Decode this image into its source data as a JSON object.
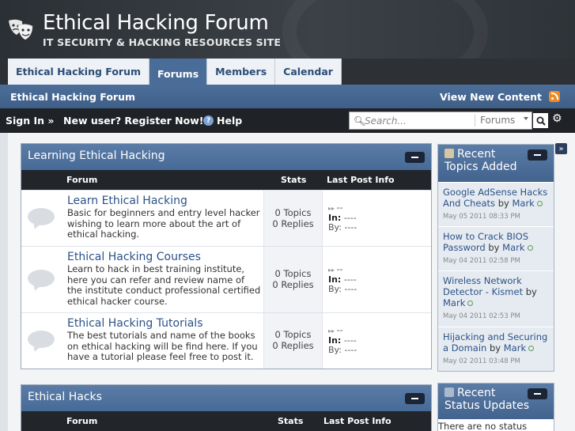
{
  "site": {
    "title": "Ethical Hacking Forum",
    "tagline": "IT SECURITY & HACKING RESOURCES SITE"
  },
  "tabs": [
    {
      "label": "Ethical Hacking Forum",
      "active": false
    },
    {
      "label": "Forums",
      "active": true
    },
    {
      "label": "Members",
      "active": false
    },
    {
      "label": "Calendar",
      "active": false
    }
  ],
  "navbar": {
    "breadcrumb": "Ethical Hacking Forum",
    "view_new_content": "View New Content",
    "rss_icon": "rss-icon"
  },
  "userbar": {
    "sign_in": "Sign In »",
    "register": "New user? Register Now!",
    "help": "Help",
    "search_placeholder": "Search...",
    "search_scope": "Forums"
  },
  "categories": [
    {
      "title": "Learning Ethical Hacking",
      "columns": {
        "forum": "Forum",
        "stats": "Stats",
        "last": "Last Post Info"
      },
      "forums": [
        {
          "title": "Learn Ethical Hacking",
          "description": "Basic for beginners and entry level hacker wishing to learn more about the art of ethical hacking.",
          "topics": "0 Topics",
          "replies": "0 Replies",
          "last_title": "--",
          "in_label": "In:",
          "in_value": "----",
          "by_label": "By:",
          "by_value": "----"
        },
        {
          "title": "Ethical Hacking Courses",
          "description": "Learn to hack in best training institute, here you can refer and review name of the institute conduct professional certified ethical hacker course.",
          "topics": "0 Topics",
          "replies": "0 Replies",
          "last_title": "--",
          "in_label": "In:",
          "in_value": "----",
          "by_label": "By:",
          "by_value": "----"
        },
        {
          "title": "Ethical Hacking Tutorials",
          "description": "The best tutorials and name of the books on ethical hacking will be find here. If you have a tutorial please feel free to post it.",
          "topics": "0 Topics",
          "replies": "0 Replies",
          "last_title": "--",
          "in_label": "In:",
          "in_value": "----",
          "by_label": "By:",
          "by_value": "----"
        }
      ]
    },
    {
      "title": "Ethical Hacks",
      "columns": {
        "forum": "Forum",
        "stats": "Stats",
        "last": "Last Post Info"
      }
    }
  ],
  "sidebar": {
    "recent_topics": {
      "title_line1": "Recent",
      "title_line2": "Topics Added",
      "items": [
        {
          "title": "Google AdSense Hacks And Cheats",
          "by": "by",
          "author": "Mark",
          "date": "May 05 2011 08:33 PM"
        },
        {
          "title": "How to Crack BIOS Password",
          "by": "by",
          "author": "Mark",
          "date": "May 04 2011 02:58 PM"
        },
        {
          "title": "Wireless Network Detector - Kismet",
          "by": "by",
          "author": "Mark",
          "date": "May 04 2011 02:53 PM"
        },
        {
          "title": "Hijacking and Securing a Domain",
          "by": "by",
          "author": "Mark",
          "date": "May 02 2011 03:48 PM"
        }
      ]
    },
    "status_updates": {
      "title_line1": "Recent",
      "title_line2": "Status Updates",
      "empty_text": "There are no status"
    }
  },
  "colors": {
    "header_bg": "#33383d",
    "accent_blue": "#4a6c98",
    "link_blue": "#2b5287",
    "dark_bar": "#22262b",
    "rss_orange": "#f08a24"
  }
}
